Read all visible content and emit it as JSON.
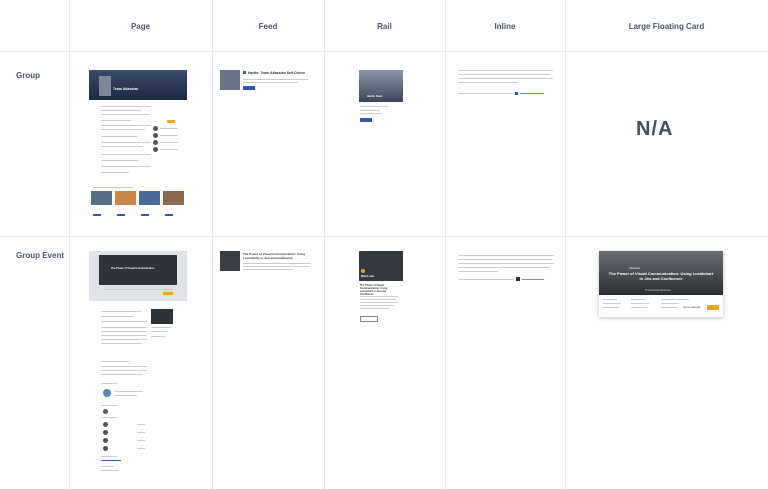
{
  "columns": [
    "Page",
    "Feed",
    "Rail",
    "Inline",
    "Large Floating Card"
  ],
  "rows": [
    "Group",
    "Group Event"
  ],
  "na_label": "N/A",
  "group": {
    "feed_title": "Hartfo: Team Atlassian Self-Driven",
    "rail_title": "Hartfo: Team Atlassian Self-Driven",
    "rail_button": "Join group"
  },
  "event": {
    "feed_title": "The Power of Visual Communication: Using Loom/Gliffy to Jira and Confluence",
    "rail_badge": "Watch now",
    "rail_title": "The Power of Visual Communication: Using Lucidchart in Jira and Confluence",
    "card_title": "The Power of Visual Communication: Using Lucidchart in Jira and Confluence",
    "card_subtitle": "Professional Workshop",
    "card_button": "Register",
    "card_secondary": "Add to calendar"
  },
  "colors": {
    "accent_blue": "#2f56b8",
    "accent_orange": "#f2a41c",
    "grid": "#e8e9ec",
    "heading": "#4a5568"
  }
}
